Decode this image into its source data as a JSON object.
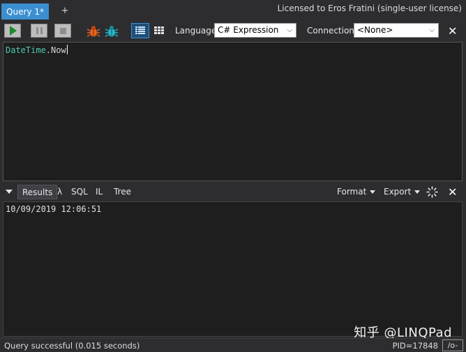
{
  "tabs": {
    "active_label": "Query 1*",
    "add_label": "+"
  },
  "license_text": "Licensed to Eros Fratini (single-user license)",
  "toolbar": {
    "language_label": "Language",
    "language_value": "C# Expression",
    "connection_label": "Connection",
    "connection_value": "<None>",
    "close_label": "✕",
    "icons": [
      "play-icon",
      "pause-icon",
      "stop-icon",
      "bug-orange-icon",
      "bug-teal-icon",
      "grid-rows-icon",
      "grid-cells-icon"
    ]
  },
  "editor": {
    "tokens": {
      "type": "DateTime",
      "dot": ".",
      "member": "Now"
    }
  },
  "results_bar": {
    "tabs": [
      "Results",
      "λ",
      "SQL",
      "IL",
      "Tree"
    ],
    "format_label": "Format",
    "export_label": "Export",
    "close_label": "✕"
  },
  "results": {
    "value": "10/09/2019 12:06:51"
  },
  "watermark": "知乎 @LINQPad",
  "status": {
    "message": "Query successful  (0.015 seconds)",
    "pid": "PID=17848",
    "mode": "/o-"
  },
  "colors": {
    "background": "#2d2d30",
    "editor_bg": "#1e1e1e",
    "tab_active": "#3b8fd1",
    "type_token": "#4ec9b0",
    "run_green": "#1e8a2e"
  }
}
